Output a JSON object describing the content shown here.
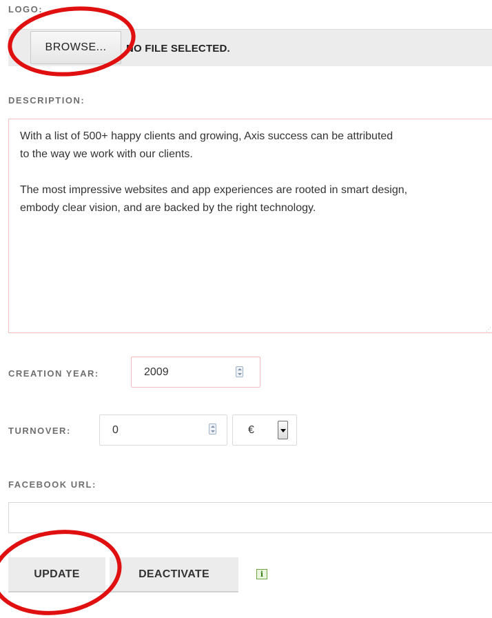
{
  "form": {
    "logo_label": "LOGO:",
    "browse_button": "BROWSE...",
    "file_status": "NO FILE SELECTED.",
    "description_label": "DESCRIPTION:",
    "description_value": "With a list of 500+ happy clients and growing, Axis success can be attributed\nto the way we work with our clients.\n\nThe most impressive websites and app experiences are rooted in smart design,\nembody clear vision, and are backed by the right technology.",
    "creation_year_label": "CREATION YEAR:",
    "creation_year_value": "2009",
    "turnover_label": "TURNOVER:",
    "turnover_value": "0",
    "currency_selected": "€",
    "facebook_url_label": "FACEBOOK URL:",
    "facebook_url_value": "",
    "update_button": "UPDATE",
    "deactivate_button": "DEACTIVATE",
    "info_icon_glyph": "i"
  },
  "colors": {
    "annotation_circle": "#e01010",
    "error_border": "#f3bcbc",
    "info_green": "#2f7a12"
  },
  "icons": [
    "spinner-icon",
    "dropdown-arrow-icon",
    "info-icon"
  ]
}
